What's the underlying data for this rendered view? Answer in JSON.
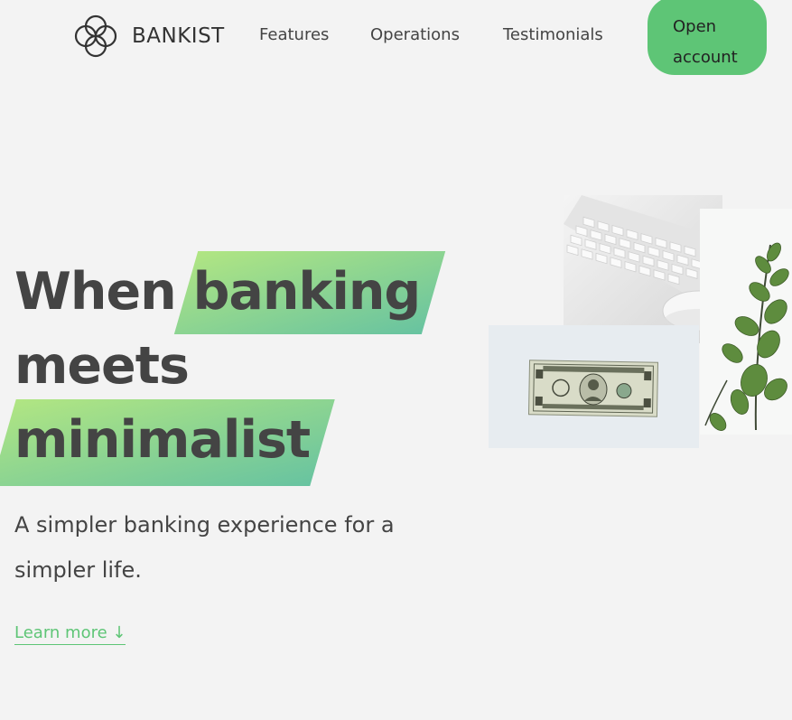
{
  "nav": {
    "brand": "BANKIST",
    "links": [
      {
        "label": "Features"
      },
      {
        "label": "Operations"
      },
      {
        "label": "Testimonials"
      }
    ],
    "cta_label_line1": "Open",
    "cta_label_line2": "account"
  },
  "hero": {
    "title_word1": "When",
    "title_word2": "banking",
    "title_word3": "meets",
    "title_word4": "minimalist",
    "subtitle": "A simpler banking experience for a simpler life.",
    "learn_more": "Learn more ↓"
  },
  "colors": {
    "accent": "#5ec576",
    "gradient_start": "#9be15d",
    "gradient_end": "#39b385",
    "background": "#f3f3f3",
    "text": "#444444"
  }
}
